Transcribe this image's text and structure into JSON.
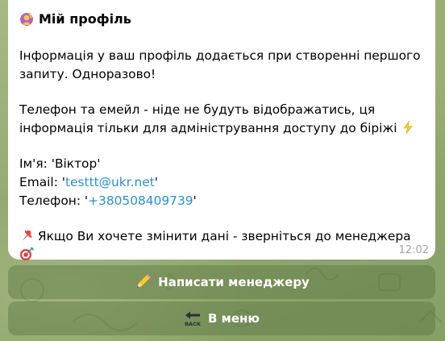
{
  "message": {
    "title": "Мій профіль",
    "title_icon": "person-raising-hand-icon",
    "intro": "Інформація у ваш профіль додається при створенні першого запиту. Одноразово!",
    "privacy_note": "Телефон та емейл - ніде не будуть відображатись, ця інформація тільки для адміністрування доступу до біріжі",
    "privacy_icon": "lightning-icon",
    "name_label": "Ім'я: ",
    "name_value": "'Віктор'",
    "email_label": "Email: ",
    "email_quote_open": "'",
    "email_value": "testtt@ukr.net",
    "email_quote_close": "'",
    "phone_label": "Телефон:  ",
    "phone_quote_open": "'",
    "phone_value": "+380508409739",
    "phone_quote_close": "'",
    "contact_note": "Якщо Ви хочете змінити дані - зверніться до менеджера",
    "contact_note_prefix_icon": "pushpin-icon",
    "contact_note_suffix_icon": "target-icon",
    "time": "12:02"
  },
  "keyboard": {
    "buttons": [
      {
        "label": "Написати менеджеру",
        "icon": "pencil-icon"
      },
      {
        "label": "В меню",
        "icon": "back-arrow-icon"
      }
    ]
  },
  "colors": {
    "link": "#2a8fd0",
    "bubble": "#ffffff",
    "button_bg": "#6f8a52",
    "time": "#a3a3a3"
  }
}
